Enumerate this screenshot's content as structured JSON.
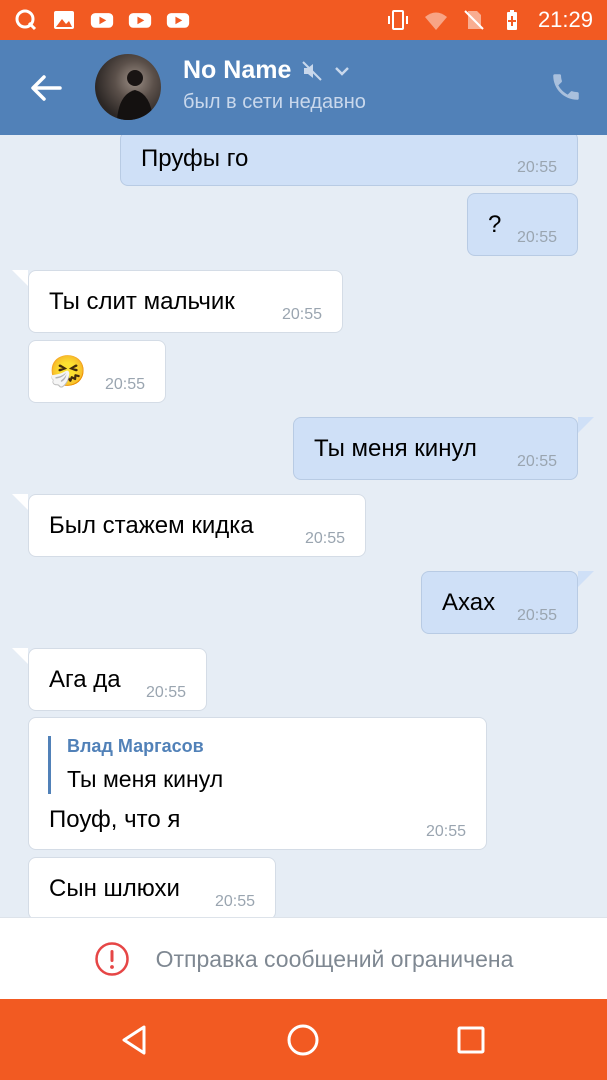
{
  "status_bar": {
    "time": "21:29",
    "left_icons": [
      "q-app-icon",
      "image-icon",
      "youtube-icon",
      "youtube-icon",
      "youtube-icon"
    ],
    "right_icons": [
      "vibrate-icon",
      "wifi-icon",
      "no-sim-icon",
      "battery-charging-icon"
    ]
  },
  "header": {
    "name": "No Name",
    "status": "был в сети недавно",
    "icons": [
      "back-arrow-icon",
      "muted-icon",
      "chevron-down-icon",
      "phone-icon"
    ]
  },
  "messages": [
    {
      "direction": "out",
      "text": "Пруфы го",
      "time": "20:55"
    },
    {
      "direction": "out",
      "text": "?",
      "time": "20:55"
    },
    {
      "direction": "in",
      "text": "Ты слит мальчик",
      "time": "20:55"
    },
    {
      "direction": "in",
      "emoji": "🤧",
      "time": "20:55"
    },
    {
      "direction": "out",
      "text": "Ты меня кинул",
      "time": "20:55"
    },
    {
      "direction": "in",
      "text": "Был стажем кидка",
      "time": "20:55"
    },
    {
      "direction": "out",
      "text": "Ахах",
      "time": "20:55"
    },
    {
      "direction": "in",
      "text": "Ага да",
      "time": "20:55"
    },
    {
      "direction": "in",
      "reply_author": "Влад Маргасов",
      "reply_text": "Ты меня кинул",
      "text": "Поуф, что я",
      "time": "20:55"
    },
    {
      "direction": "in",
      "text": "Сын шлюхи",
      "time": "20:55"
    }
  ],
  "footer": {
    "restriction_text": "Отправка сообщений ограничена",
    "icon": "error-circle-icon"
  },
  "nav_bar": {
    "buttons": [
      "back-triangle-icon",
      "home-circle-icon",
      "recents-square-icon"
    ]
  },
  "colors": {
    "accent": "#5181b8",
    "status_bar": "#f25a22",
    "outgoing_bubble": "#cfe0f7",
    "chat_bg": "#e6edf5"
  }
}
